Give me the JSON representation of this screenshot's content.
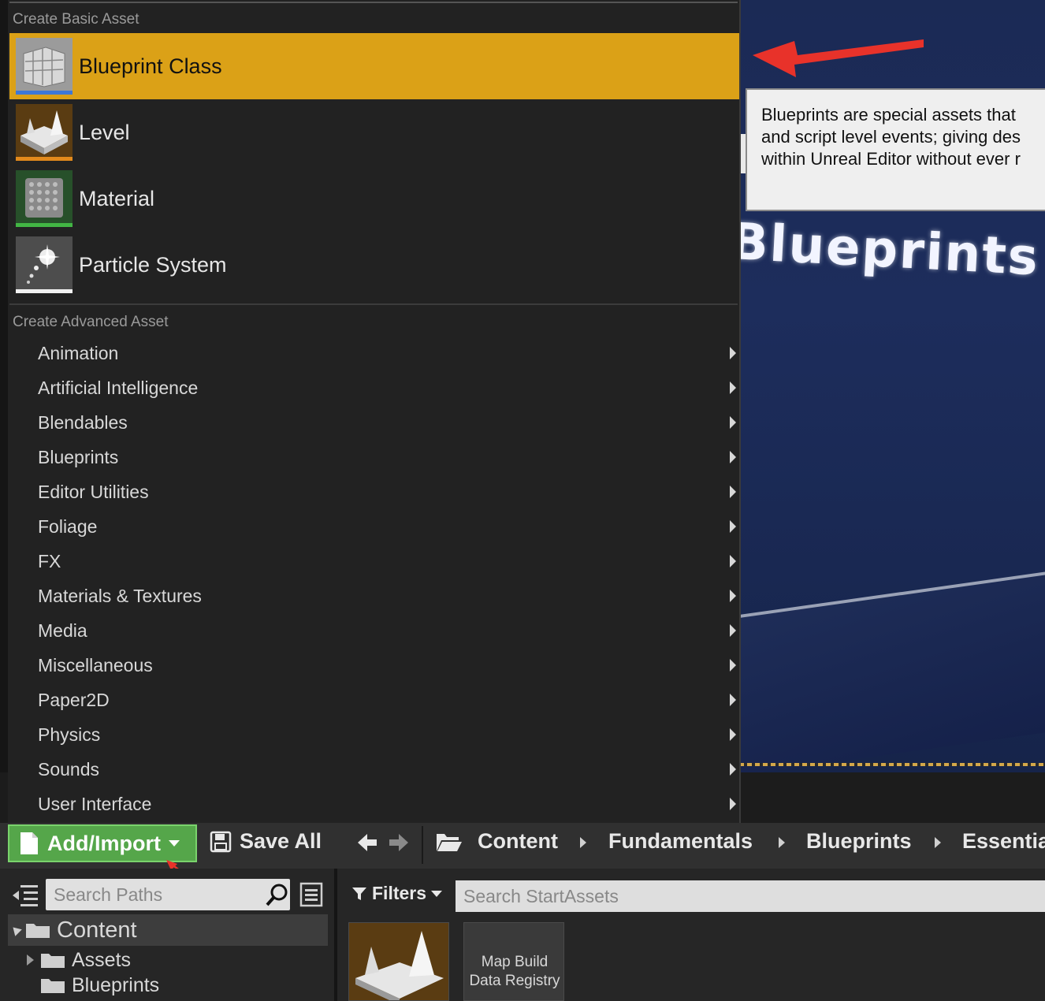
{
  "menu": {
    "basic_title": "Create Basic Asset",
    "basic_items": [
      {
        "label": "Blueprint Class",
        "bar_color": "#3d78d6"
      },
      {
        "label": "Level",
        "bar_color": "#e38a1c"
      },
      {
        "label": "Material",
        "bar_color": "#42b544"
      },
      {
        "label": "Particle System",
        "bar_color": "#f2f2f2"
      }
    ],
    "advanced_title": "Create Advanced Asset",
    "advanced_items": [
      "Animation",
      "Artificial Intelligence",
      "Blendables",
      "Blueprints",
      "Editor Utilities",
      "Foliage",
      "FX",
      "Materials & Textures",
      "Media",
      "Miscellaneous",
      "Paper2D",
      "Physics",
      "Sounds",
      "User Interface"
    ],
    "highlight_color": "#dba117"
  },
  "tooltip": {
    "lines": [
      "Blueprints are special assets that",
      "and script level events; giving des",
      "within Unreal Editor without ever r"
    ]
  },
  "viewport": {
    "sign_text": "Blueprints in"
  },
  "toolbar": {
    "add_import_label": "Add/Import",
    "save_all_label": "Save All",
    "breadcrumbs": [
      "Content",
      "Fundamentals",
      "Blueprints",
      "Essentia"
    ]
  },
  "sources": {
    "search_placeholder": "Search Paths",
    "tree": [
      {
        "label": "Content"
      },
      {
        "label": "Assets"
      },
      {
        "label": "Blueprints"
      }
    ]
  },
  "assets": {
    "filters_label": "Filters",
    "search_placeholder": "Search StartAssets",
    "tiles": [
      {
        "label": ""
      },
      {
        "label": "Map Build Data Registry",
        "line1": "Map Build",
        "line2": "Data Registry"
      }
    ]
  },
  "colors": {
    "accent_green": "#55a64a",
    "annotation_red": "#e8322a"
  }
}
